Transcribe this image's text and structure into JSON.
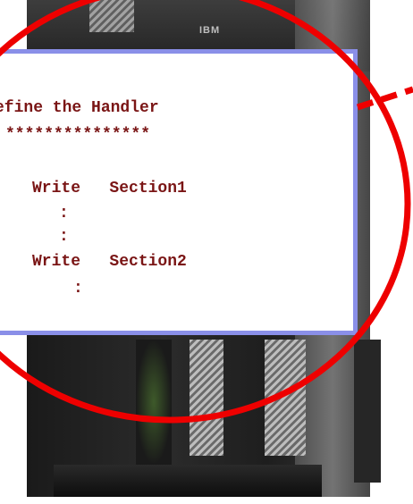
{
  "hardware": {
    "brand_logo": "IBM"
  },
  "code_listing": {
    "lines": [
      "efine the Handler",
      "***************",
      "Write   Section1",
      ":",
      ":",
      "Write   Section2",
      ":"
    ]
  },
  "colors": {
    "code_text": "#7a1515",
    "panel_border": "#8a8fe8",
    "highlight_circle": "#ee0000"
  }
}
